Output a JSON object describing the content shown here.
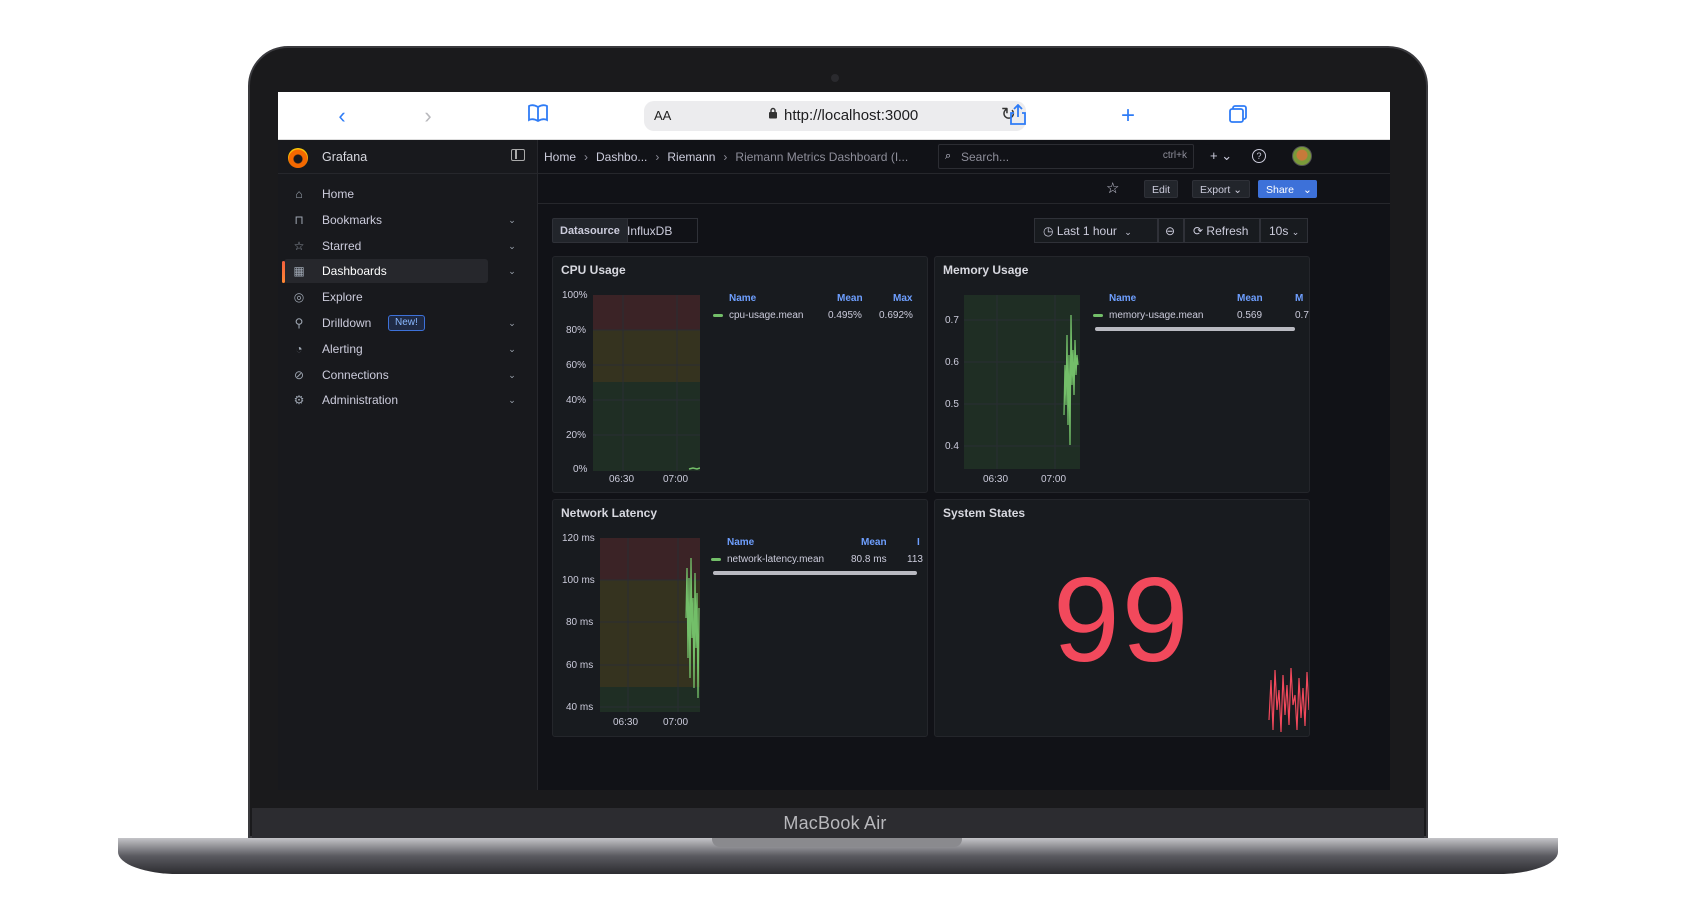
{
  "device": {
    "brand": "MacBook Air"
  },
  "browser": {
    "url": "http://localhost:3000",
    "reader_label": "AA"
  },
  "grafana": {
    "app_title": "Grafana",
    "nav": [
      {
        "label": "Home",
        "icon": "home-icon",
        "expandable": false,
        "active": false
      },
      {
        "label": "Bookmarks",
        "icon": "bookmark-icon",
        "expandable": true,
        "active": false
      },
      {
        "label": "Starred",
        "icon": "star-icon",
        "expandable": true,
        "active": false
      },
      {
        "label": "Dashboards",
        "icon": "apps-icon",
        "expandable": true,
        "active": true
      },
      {
        "label": "Explore",
        "icon": "compass-icon",
        "expandable": false,
        "active": false
      },
      {
        "label": "Drilldown",
        "icon": "drilldown-icon",
        "expandable": true,
        "active": false,
        "badge": "New!"
      },
      {
        "label": "Alerting",
        "icon": "bell-icon",
        "expandable": true,
        "active": false
      },
      {
        "label": "Connections",
        "icon": "link-icon",
        "expandable": true,
        "active": false
      },
      {
        "label": "Administration",
        "icon": "cog-icon",
        "expandable": true,
        "active": false
      }
    ],
    "breadcrumbs": [
      "Home",
      "Dashbo...",
      "Riemann",
      "Riemann Metrics Dashboard (I..."
    ],
    "search": {
      "placeholder": "Search...",
      "shortcut": "ctrl+k"
    },
    "actions": {
      "edit": "Edit",
      "export": "Export",
      "share": "Share"
    },
    "variables": {
      "label": "Datasource",
      "value": "InfluxDB"
    },
    "time": {
      "range": "Last 1 hour",
      "refresh": "Refresh",
      "interval": "10s"
    },
    "accent": "#3d71d9"
  },
  "panels": {
    "cpu": {
      "title": "CPU Usage",
      "legend": {
        "headers": [
          "Name",
          "Mean",
          "Max"
        ],
        "series": "cpu-usage.mean",
        "mean": "0.495%",
        "max": "0.692%"
      },
      "y_ticks": [
        "100%",
        "80%",
        "60%",
        "40%",
        "20%",
        "0%"
      ],
      "x_ticks": [
        "06:30",
        "07:00"
      ]
    },
    "memory": {
      "title": "Memory Usage",
      "legend": {
        "headers": [
          "Name",
          "Mean",
          "M"
        ],
        "series": "memory-usage.mean",
        "mean": "0.569",
        "max": "0.7"
      },
      "y_ticks": [
        "0.7",
        "0.6",
        "0.5",
        "0.4"
      ],
      "x_ticks": [
        "06:30",
        "07:00"
      ]
    },
    "latency": {
      "title": "Network Latency",
      "legend": {
        "headers": [
          "Name",
          "Mean",
          "I"
        ],
        "series": "network-latency.mean",
        "mean": "80.8 ms",
        "max": "113"
      },
      "y_ticks": [
        "120 ms",
        "100 ms",
        "80 ms",
        "60 ms",
        "40 ms"
      ],
      "x_ticks": [
        "06:30",
        "07:00"
      ]
    },
    "states": {
      "title": "System States",
      "value": "99",
      "color": "#f2495c"
    }
  },
  "threshold_colors": {
    "red": "#3b2326",
    "yellow": "#35331f",
    "green": "#1f2e24",
    "line": "#73bf69"
  }
}
